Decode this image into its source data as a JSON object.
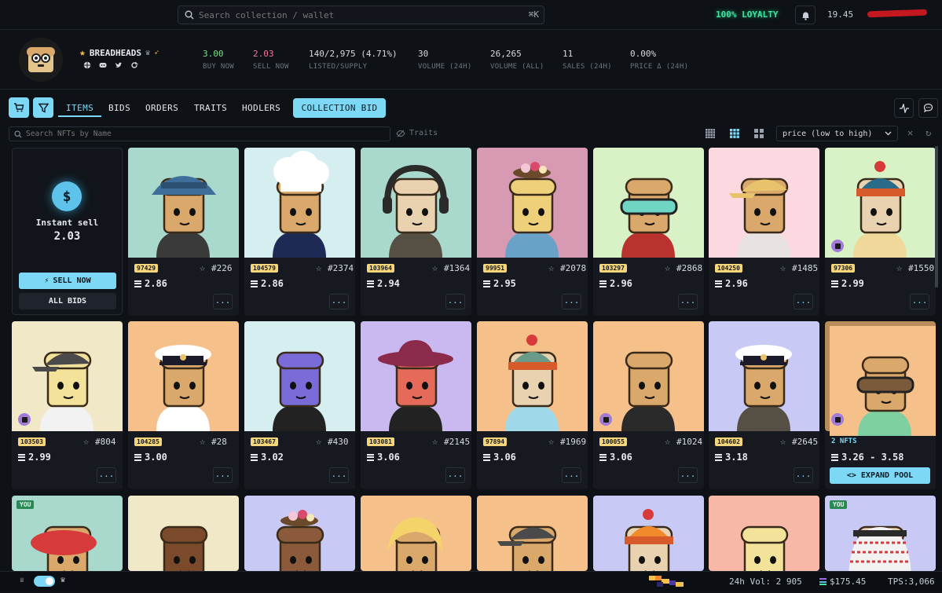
{
  "topbar": {
    "search_placeholder": "Search collection / wallet",
    "kbd": "⌘K",
    "loyalty": "100% LOYALTY",
    "balance": "19.45"
  },
  "collection": {
    "name": "BREADHEADS",
    "stats": [
      {
        "value": "3.00",
        "label": "BUY NOW",
        "color": "#7ee08a"
      },
      {
        "value": "2.03",
        "label": "SELL NOW",
        "color": "#f07a9b"
      },
      {
        "value": "140/2,975 (4.71%)",
        "label": "LISTED/SUPPLY",
        "color": "#d7dbe1"
      },
      {
        "value": "30",
        "label": "VOLUME (24H)",
        "color": "#d7dbe1"
      },
      {
        "value": "26,265",
        "label": "VOLUME (ALL)",
        "color": "#d7dbe1"
      },
      {
        "value": "11",
        "label": "SALES (24H)",
        "color": "#d7dbe1"
      },
      {
        "value": "0.00%",
        "label": "PRICE Δ (24H)",
        "color": "#d7dbe1"
      }
    ]
  },
  "tabs": {
    "items": "ITEMS",
    "bids": "BIDS",
    "orders": "ORDERS",
    "traits": "TRAITS",
    "hodlers": "HODLERS",
    "collection_bid": "COLLECTION BID"
  },
  "filter": {
    "search_placeholder": "Search NFTs by Name",
    "traits": "Traits",
    "sort": "price (low to high)"
  },
  "sell_panel": {
    "label": "Instant sell",
    "value": "2.03",
    "sell_now": "SELL NOW",
    "all_bids": "ALL BIDS"
  },
  "cards": [
    {
      "id": "97429",
      "rank": "#226",
      "price": "2.86",
      "bg": "#a9d8cc",
      "skin": "#d9a86a",
      "hat": "bucket",
      "accent": "#3d6f9a",
      "body": "#3a3a3a",
      "mne": false,
      "you": false
    },
    {
      "id": "104579",
      "rank": "#2374",
      "price": "2.86",
      "bg": "#d5eef0",
      "skin": "#d9a86a",
      "hat": "chef",
      "accent": "#ffffff",
      "body": "#1e2a55",
      "mne": false,
      "you": false
    },
    {
      "id": "103964",
      "rank": "#1364",
      "price": "2.94",
      "bg": "#a9d8cc",
      "skin": "#e8d2b0",
      "hat": "headphones",
      "accent": "#e9485e",
      "body": "#555043",
      "mne": false,
      "you": false
    },
    {
      "id": "99951",
      "rank": "#2078",
      "price": "2.95",
      "bg": "#d79ab2",
      "skin": "#efd07a",
      "hat": "cake",
      "accent": "#c9663b",
      "body": "#6aa1c7",
      "mne": false,
      "you": false
    },
    {
      "id": "103297",
      "rank": "#2868",
      "price": "2.96",
      "bg": "#d8f2c6",
      "skin": "#d9a86a",
      "hat": "goggles",
      "accent": "#6fd6c4",
      "body": "#b9322e",
      "mne": false,
      "you": false
    },
    {
      "id": "104250",
      "rank": "#1485",
      "price": "2.96",
      "bg": "#fcd9e0",
      "skin": "#d9a86a",
      "hat": "cap",
      "accent": "#e9c36b",
      "body": "#e8e2e2",
      "mne": false,
      "you": false
    },
    {
      "id": "97306",
      "rank": "#1550",
      "price": "2.99",
      "bg": "#d8f2c6",
      "skin": "#e8d2b0",
      "hat": "beanie",
      "accent": "#2b6b8a",
      "body": "#f0d79a",
      "mne": true,
      "you": false
    },
    {
      "id": "103503",
      "rank": "#804",
      "price": "2.99",
      "bg": "#f1e8c8",
      "skin": "#f3e39a",
      "hat": "cap",
      "accent": "#4a4a4a",
      "body": "#f2f2f2",
      "mne": true,
      "you": false
    },
    {
      "id": "104285",
      "rank": "#28",
      "price": "3.00",
      "bg": "#f6c08a",
      "skin": "#d9a86a",
      "hat": "captain",
      "accent": "#ffffff",
      "body": "#ffffff",
      "mne": false,
      "you": false
    },
    {
      "id": "103467",
      "rank": "#430",
      "price": "3.02",
      "bg": "#d5eef0",
      "skin": "#7a6cd8",
      "hat": "none",
      "accent": "#e9485e",
      "body": "#222222",
      "mne": false,
      "you": false
    },
    {
      "id": "103081",
      "rank": "#2145",
      "price": "3.06",
      "bg": "#c9b9f0",
      "skin": "#e56a5a",
      "hat": "wide",
      "accent": "#8b2a4a",
      "body": "#222222",
      "mne": false,
      "you": false
    },
    {
      "id": "97894",
      "rank": "#1969",
      "price": "3.06",
      "bg": "#f6c08a",
      "skin": "#e8d2b0",
      "hat": "beanie",
      "accent": "#6a9a8a",
      "body": "#9fd8e8",
      "mne": false,
      "you": false
    },
    {
      "id": "100055",
      "rank": "#1024",
      "price": "3.06",
      "bg": "#f6c08a",
      "skin": "#d9a86a",
      "hat": "none",
      "accent": "#c9853b",
      "body": "#2a2a2a",
      "mne": true,
      "you": false
    },
    {
      "id": "104602",
      "rank": "#2645",
      "price": "3.18",
      "bg": "#c9c9f5",
      "skin": "#d9a86a",
      "hat": "captain",
      "accent": "#6fd6c4",
      "body": "#555043",
      "mne": false,
      "you": false
    },
    {
      "id": "",
      "rank": "",
      "price": "",
      "bg": "#f6c08a",
      "skin": "#d9a86a",
      "hat": "goggles",
      "accent": "#7a5a3a",
      "body": "#7fd0a0",
      "mne": true,
      "you": false
    },
    {
      "id": "",
      "rank": "",
      "price": "",
      "bg": "#a9d8cc",
      "skin": "#d9a86a",
      "hat": "beret",
      "accent": "#d63a3a",
      "body": "#3a3a3a",
      "mne": false,
      "you": true
    },
    {
      "id": "",
      "rank": "",
      "price": "",
      "bg": "#f1e8c8",
      "skin": "#7a4a2a",
      "hat": "none",
      "accent": "#5a3a22",
      "body": "#3a3a3a",
      "mne": false,
      "you": false
    },
    {
      "id": "",
      "rank": "",
      "price": "",
      "bg": "#c9c9f5",
      "skin": "#8a5a3a",
      "hat": "cake",
      "accent": "#6fd6c4",
      "body": "#3a3a3a",
      "mne": false,
      "you": false
    },
    {
      "id": "",
      "rank": "",
      "price": "",
      "bg": "#f6c08a",
      "skin": "#d9a86a",
      "hat": "hair",
      "accent": "#f3d36a",
      "body": "#3a3a3a",
      "mne": false,
      "you": false
    },
    {
      "id": "",
      "rank": "",
      "price": "",
      "bg": "#f6c08a",
      "skin": "#d9a86a",
      "hat": "cap",
      "accent": "#4a4a4a",
      "body": "#3a3a3a",
      "mne": false,
      "you": false
    },
    {
      "id": "",
      "rank": "",
      "price": "",
      "bg": "#c9c9f5",
      "skin": "#e8d2b0",
      "hat": "beanie",
      "accent": "#f08a2a",
      "body": "#3a3a3a",
      "mne": false,
      "you": false
    },
    {
      "id": "",
      "rank": "",
      "price": "",
      "bg": "#f8b8a8",
      "skin": "#f3e39a",
      "hat": "none",
      "accent": "#f3e39a",
      "body": "#3a3a3a",
      "mne": false,
      "you": false
    },
    {
      "id": "",
      "rank": "",
      "price": "",
      "bg": "#c9c9f5",
      "skin": "#e8d2b0",
      "hat": "keffiyeh",
      "accent": "#d63a3a",
      "body": "#3a3a3a",
      "mne": false,
      "you": true
    }
  ],
  "pool": {
    "count": "2 NFTS",
    "range": "3.26 - 3.58",
    "expand": "<> EXPAND POOL"
  },
  "you_label": "YOU",
  "more_label": "...",
  "bottombar": {
    "vol24": "24h Vol: 2 905",
    "solusd": "$175.45",
    "tps": "TPS:3,066"
  }
}
